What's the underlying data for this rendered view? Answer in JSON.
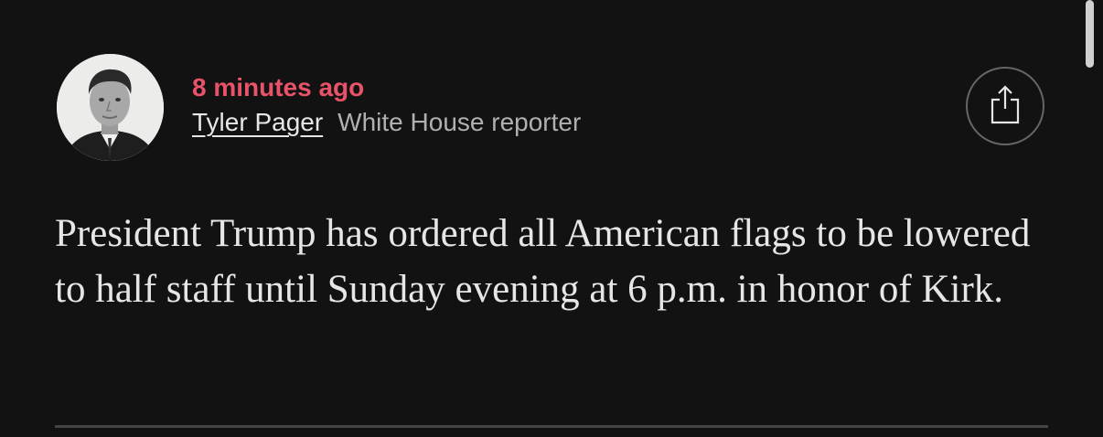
{
  "post": {
    "timestamp": "8 minutes ago",
    "author_name": "Tyler Pager",
    "author_role": "White House reporter",
    "body": "President Trump has ordered all American flags to be lowered to half staff until Sunday evening at 6 p.m. in honor of Kirk."
  },
  "icons": {
    "share": "share-icon",
    "avatar": "author-avatar"
  },
  "colors": {
    "background": "#121212",
    "timestamp": "#e9536a",
    "text": "#e6e6e6",
    "secondary_text": "#b0b0b0",
    "divider": "#444444"
  }
}
